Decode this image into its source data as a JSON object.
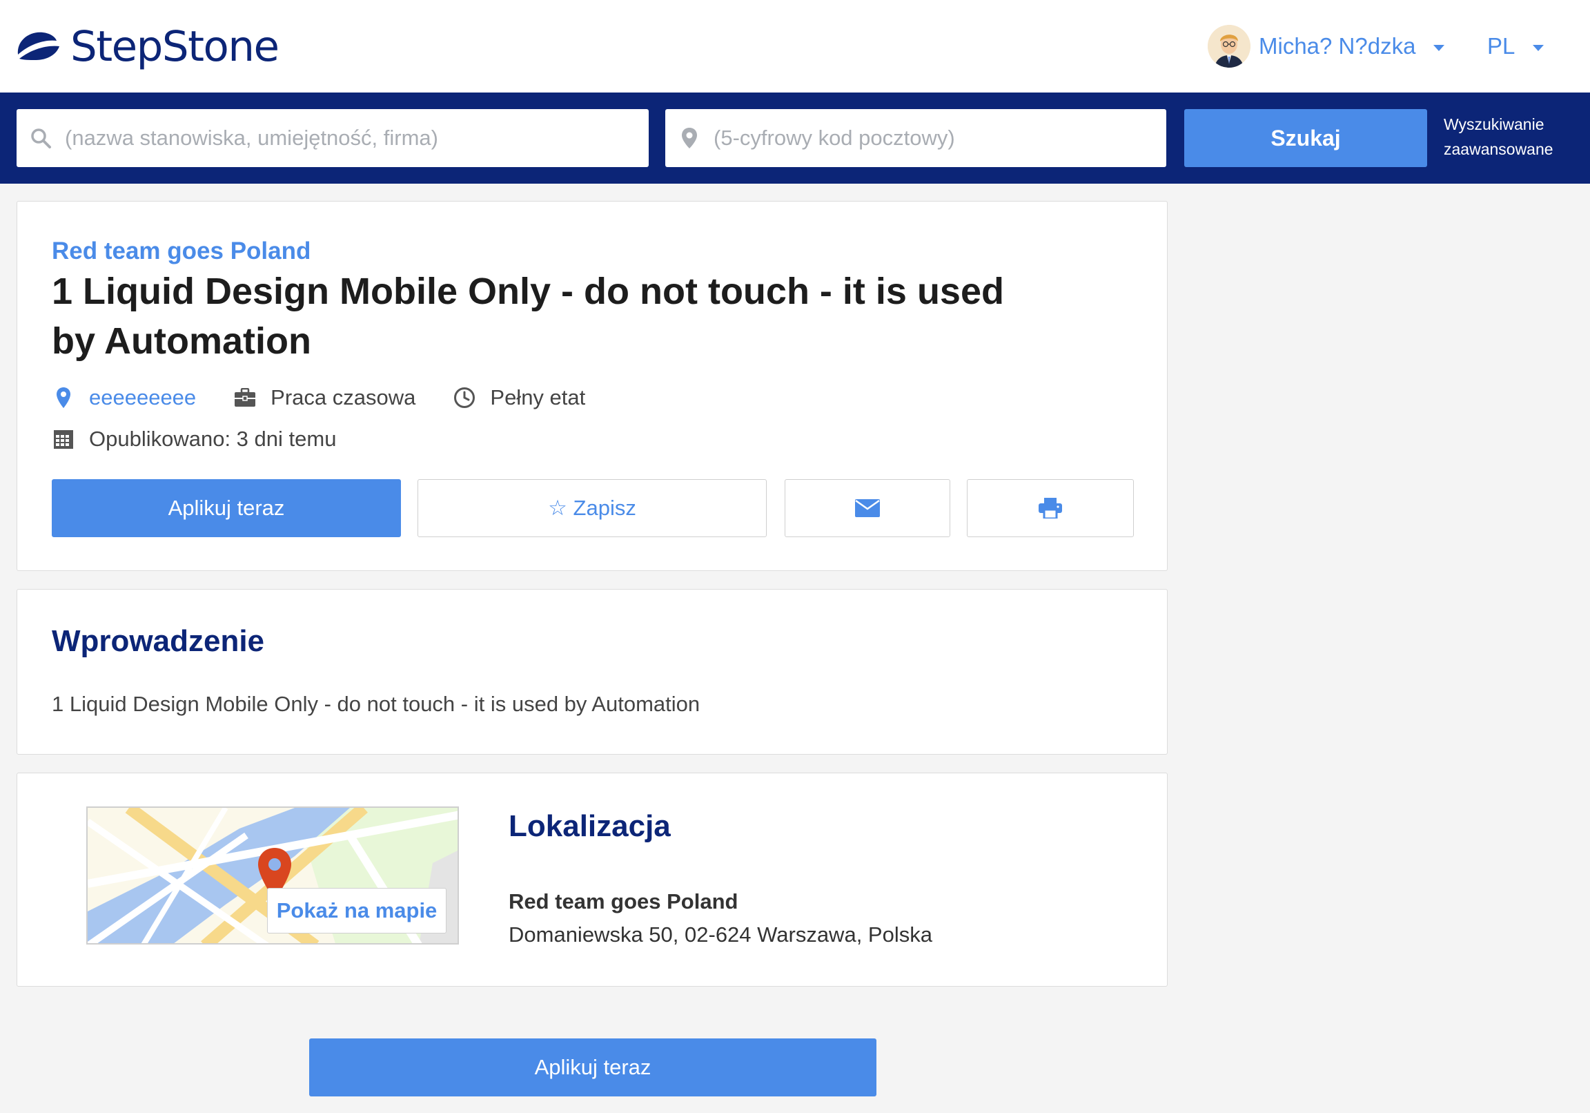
{
  "header": {
    "logo_text": "StepStone",
    "user_name": "Micha? N?dzka",
    "language": "PL",
    "brand_color": "#0c2577",
    "accent_color": "#4a8be8"
  },
  "search": {
    "job_placeholder": "(nazwa stanowiska, umiejętność, firma)",
    "zip_placeholder": "(5-cyfrowy kod pocztowy)",
    "search_button": "Szukaj",
    "advanced_line1": "Wyszukiwanie",
    "advanced_line2": "zaawansowane"
  },
  "job": {
    "company": "Red team goes Poland",
    "title": "1 Liquid Design Mobile Only - do not touch - it is used by Automation",
    "location": "eeeeeeeee",
    "contract": "Praca czasowa",
    "schedule": "Pełny etat",
    "published": "Opublikowano: 3 dni temu",
    "apply_button": "Aplikuj teraz",
    "save_button": "☆ Zapisz",
    "icons": [
      "location-pin-icon",
      "briefcase-icon",
      "clock-icon",
      "calendar-icon",
      "star-icon",
      "envelope-icon",
      "printer-icon"
    ]
  },
  "intro": {
    "heading": "Wprowadzenie",
    "text": "1 Liquid Design Mobile Only - do not touch - it is used by Automation"
  },
  "location": {
    "heading": "Lokalizacja",
    "map_button": "Pokaż na mapie",
    "company": "Red team goes Poland",
    "address": "Domaniewska 50, 02-624 Warszawa, Polska"
  },
  "footer": {
    "apply_button": "Aplikuj teraz"
  }
}
